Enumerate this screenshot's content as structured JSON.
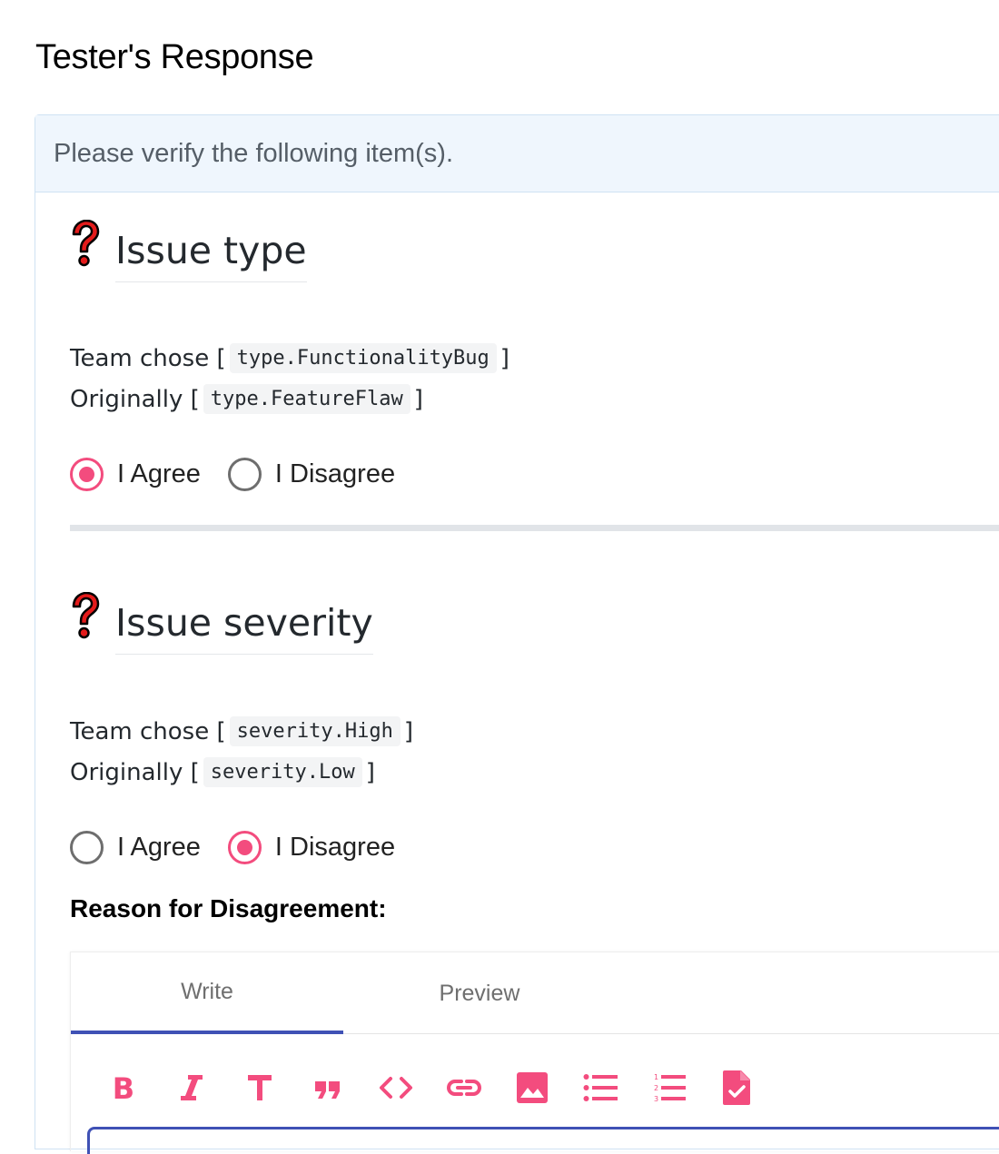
{
  "page": {
    "title": "Tester's Response"
  },
  "card": {
    "header": "Please verify the following item(s)."
  },
  "items": [
    {
      "heading": "Issue type",
      "team_chose_label": "Team chose",
      "team_value": "type.FunctionalityBug",
      "originally_label": "Originally",
      "original_value": "type.FeatureFlaw",
      "agree_label": "I Agree",
      "disagree_label": "I Disagree",
      "selected": "agree"
    },
    {
      "heading": "Issue severity",
      "team_chose_label": "Team chose",
      "team_value": "severity.High",
      "originally_label": "Originally",
      "original_value": "severity.Low",
      "agree_label": "I Agree",
      "disagree_label": "I Disagree",
      "selected": "disagree"
    }
  ],
  "reason": {
    "label": "Reason for Disagreement:"
  },
  "editor": {
    "tabs": [
      {
        "label": "Write",
        "active": true
      },
      {
        "label": "Preview",
        "active": false
      }
    ],
    "toolbar": [
      "bold-icon",
      "italic-icon",
      "heading-icon",
      "quote-icon",
      "code-icon",
      "link-icon",
      "image-icon",
      "bulleted-list-icon",
      "numbered-list-icon",
      "task-list-icon"
    ]
  },
  "colors": {
    "accent": "#f34c7e",
    "tab_indicator": "#3f51b5",
    "header_bg": "#eff6fd"
  }
}
